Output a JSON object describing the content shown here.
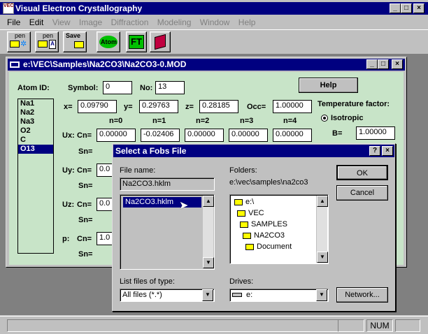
{
  "app": {
    "title": "Visual Electron Crystallography",
    "menu": [
      "File",
      "Edit",
      "View",
      "Image",
      "Diffraction",
      "Modeling",
      "Window",
      "Help"
    ],
    "toolbar": [
      {
        "top": "pen",
        "bottom": ""
      },
      {
        "top": "pen",
        "bottom": ""
      },
      {
        "top": "Save",
        "bottom": ""
      },
      {
        "top": "Atom",
        "bottom": ""
      },
      {
        "top": "FT",
        "bottom": ""
      },
      {
        "top": "",
        "bottom": ""
      }
    ]
  },
  "mdi": {
    "title": "e:\\VEC\\Samples\\Na2CO3\\Na2CO3-0.MOD",
    "atom_id_label": "Atom ID:",
    "symbol_label": "Symbol:",
    "symbol_value": "0",
    "no_label": "No:",
    "no_value": "13",
    "help_label": "Help",
    "atoms": [
      "Na1",
      "Na2",
      "Na3",
      "O2",
      "C",
      "O13"
    ],
    "selected_atom": "O13",
    "x_label": "x=",
    "x_value": "0.09790",
    "y_label": "y=",
    "y_value": "0.29763",
    "z_label": "z=",
    "z_value": "0.28185",
    "occ_label": "Occ=",
    "occ_value": "1.00000",
    "temp_label": "Temperature factor:",
    "isotropic_label": "Isotropic",
    "b_label": "B=",
    "b_value": "1.00000",
    "n_headers": [
      "n=0",
      "n=1",
      "n=2",
      "n=3",
      "n=4"
    ],
    "ux_label": "Ux:",
    "cn_label": "Cn=",
    "sn_label": "Sn=",
    "ux_cn": [
      "0.00000",
      "-0.02406",
      "0.00000",
      "0.00000",
      "0.00000"
    ],
    "uy_label": "Uy:",
    "uy_cn_partial": "0.0",
    "uz_label": "Uz:",
    "uz_cn_partial": "0.0",
    "p_label": "p:",
    "p_cn_partial": "1.0"
  },
  "dialog": {
    "title": "Select a Fobs File",
    "file_name_label": "File name:",
    "file_name_value": "Na2CO3.hklm",
    "files": [
      "Na2CO3.hklm"
    ],
    "folders_label": "Folders:",
    "folders_path": "e:\\vec\\samples\\na2co3",
    "folders": [
      "e:\\",
      "VEC",
      "SAMPLES",
      "NA2CO3",
      "Document"
    ],
    "ok_label": "OK",
    "cancel_label": "Cancel",
    "list_type_label": "List files of type:",
    "list_type_value": "All files (*.*)",
    "drives_label": "Drives:",
    "drives_value": "e:",
    "network_label": "Network..."
  },
  "status": {
    "num": "NUM"
  }
}
